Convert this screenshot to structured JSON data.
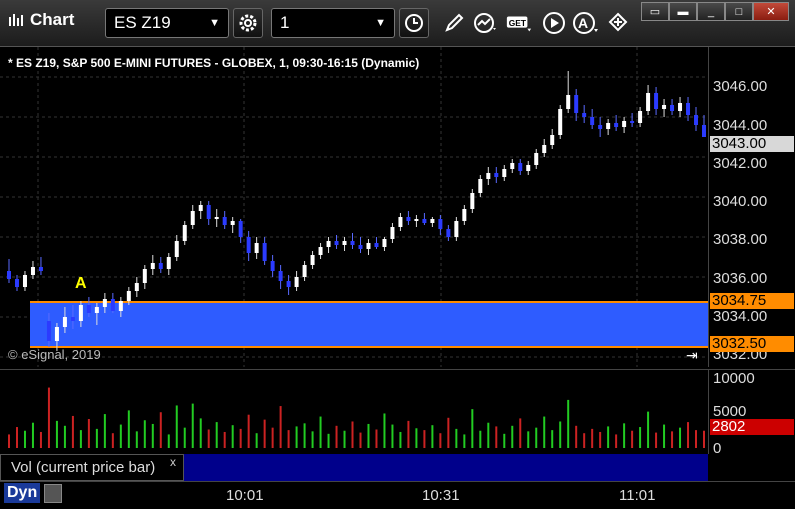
{
  "window": {
    "title": "Chart",
    "symbol": "ES Z19",
    "interval": "1",
    "buttons": [
      "clock-icon",
      "pencil-icon",
      "chart-line-icon",
      "get-icon",
      "play-icon",
      "a-circle-icon",
      "move-icon"
    ]
  },
  "chart": {
    "header": "* ES Z19, S&P 500 E-MINI FUTURES - GLOBEX, 1, 09:30-16:15 (Dynamic)",
    "copyright": "© eSignal, 2019",
    "marker": "A",
    "price_labels": [
      "3046.00",
      "3044.00",
      "3042.00",
      "3040.00",
      "3038.00",
      "3036.00",
      "3034.00",
      "3032.00"
    ],
    "current_price": "3043.00",
    "zone_high": "3034.75",
    "zone_low": "3032.50",
    "colors": {
      "up": "#ffffff",
      "down": "#2b3bff",
      "zone": "#2e5cff",
      "zone_line": "#ff8c00",
      "vol_up": "#22cc22",
      "vol_down": "#cc2222"
    }
  },
  "volume": {
    "study_label": "Vol (current price bar)",
    "close_label": "x",
    "axis_labels": [
      "10000",
      "5000",
      "0"
    ],
    "current": "2802"
  },
  "time_axis": {
    "labels": [
      "10:01",
      "10:31",
      "11:01"
    ],
    "mode": "Dyn"
  },
  "chart_data": {
    "type": "candlestick",
    "ylim": [
      3031.5,
      3047.5
    ],
    "zone": [
      3032.5,
      3034.75
    ],
    "bars": [
      [
        3036.3,
        3036.9,
        3035.7,
        3035.9
      ],
      [
        3035.9,
        3036.1,
        3035.3,
        3035.5
      ],
      [
        3035.5,
        3036.3,
        3035.3,
        3036.1
      ],
      [
        3036.1,
        3036.8,
        3035.9,
        3036.5
      ],
      [
        3036.5,
        3037.0,
        3036.1,
        3036.3
      ],
      [
        3033.8,
        3034.2,
        3032.5,
        3032.8
      ],
      [
        3032.8,
        3033.7,
        3032.3,
        3033.5
      ],
      [
        3033.5,
        3034.5,
        3033.2,
        3034.0
      ],
      [
        3034.0,
        3034.6,
        3033.4,
        3033.8
      ],
      [
        3033.8,
        3034.8,
        3033.5,
        3034.6
      ],
      [
        3034.6,
        3035.0,
        3034.0,
        3034.2
      ],
      [
        3034.2,
        3034.7,
        3033.6,
        3034.5
      ],
      [
        3034.5,
        3035.2,
        3034.2,
        3034.9
      ],
      [
        3034.9,
        3035.2,
        3034.2,
        3034.3
      ],
      [
        3034.3,
        3035.0,
        3034.0,
        3034.8
      ],
      [
        3034.8,
        3035.5,
        3034.6,
        3035.3
      ],
      [
        3035.3,
        3036.0,
        3035.0,
        3035.7
      ],
      [
        3035.7,
        3036.6,
        3035.4,
        3036.4
      ],
      [
        3036.4,
        3037.1,
        3036.1,
        3036.7
      ],
      [
        3036.7,
        3037.0,
        3036.2,
        3036.4
      ],
      [
        3036.4,
        3037.2,
        3036.1,
        3037.0
      ],
      [
        3037.0,
        3038.1,
        3036.8,
        3037.8
      ],
      [
        3037.8,
        3038.8,
        3037.6,
        3038.6
      ],
      [
        3038.6,
        3039.6,
        3038.4,
        3039.3
      ],
      [
        3039.3,
        3039.8,
        3038.9,
        3039.6
      ],
      [
        3039.6,
        3039.8,
        3038.6,
        3038.9
      ],
      [
        3038.9,
        3039.4,
        3038.5,
        3039.0
      ],
      [
        3039.0,
        3039.3,
        3038.4,
        3038.6
      ],
      [
        3038.6,
        3039.0,
        3038.2,
        3038.8
      ],
      [
        3038.8,
        3038.9,
        3037.7,
        3038.0
      ],
      [
        3038.0,
        3038.3,
        3036.8,
        3037.2
      ],
      [
        3037.2,
        3038.0,
        3036.9,
        3037.7
      ],
      [
        3037.7,
        3038.0,
        3036.6,
        3036.8
      ],
      [
        3036.8,
        3037.1,
        3036.0,
        3036.3
      ],
      [
        3036.3,
        3036.6,
        3035.4,
        3035.8
      ],
      [
        3035.8,
        3036.1,
        3035.1,
        3035.5
      ],
      [
        3035.5,
        3036.3,
        3035.3,
        3036.0
      ],
      [
        3036.0,
        3036.8,
        3035.8,
        3036.6
      ],
      [
        3036.6,
        3037.3,
        3036.4,
        3037.1
      ],
      [
        3037.1,
        3037.7,
        3036.9,
        3037.5
      ],
      [
        3037.5,
        3038.0,
        3037.2,
        3037.8
      ],
      [
        3037.8,
        3038.1,
        3037.4,
        3037.6
      ],
      [
        3037.6,
        3038.0,
        3037.3,
        3037.8
      ],
      [
        3037.8,
        3038.2,
        3037.4,
        3037.6
      ],
      [
        3037.6,
        3038.0,
        3037.2,
        3037.4
      ],
      [
        3037.4,
        3037.9,
        3037.1,
        3037.7
      ],
      [
        3037.7,
        3038.0,
        3037.4,
        3037.5
      ],
      [
        3037.5,
        3038.0,
        3037.3,
        3037.9
      ],
      [
        3037.9,
        3038.7,
        3037.7,
        3038.5
      ],
      [
        3038.5,
        3039.2,
        3038.3,
        3039.0
      ],
      [
        3039.0,
        3039.3,
        3038.6,
        3038.8
      ],
      [
        3038.8,
        3039.1,
        3038.5,
        3038.9
      ],
      [
        3038.9,
        3039.2,
        3038.6,
        3038.7
      ],
      [
        3038.7,
        3039.0,
        3038.5,
        3038.9
      ],
      [
        3038.9,
        3039.1,
        3038.1,
        3038.4
      ],
      [
        3038.4,
        3038.6,
        3037.8,
        3038.0
      ],
      [
        3038.0,
        3039.0,
        3037.8,
        3038.8
      ],
      [
        3038.8,
        3039.6,
        3038.6,
        3039.4
      ],
      [
        3039.4,
        3040.4,
        3039.2,
        3040.2
      ],
      [
        3040.2,
        3041.1,
        3040.0,
        3040.9
      ],
      [
        3040.9,
        3041.5,
        3040.6,
        3041.2
      ],
      [
        3041.2,
        3041.5,
        3040.7,
        3041.0
      ],
      [
        3041.0,
        3041.6,
        3040.8,
        3041.4
      ],
      [
        3041.4,
        3041.9,
        3041.2,
        3041.7
      ],
      [
        3041.7,
        3041.9,
        3041.1,
        3041.3
      ],
      [
        3041.3,
        3041.8,
        3041.1,
        3041.6
      ],
      [
        3041.6,
        3042.4,
        3041.4,
        3042.2
      ],
      [
        3042.2,
        3042.9,
        3042.0,
        3042.6
      ],
      [
        3042.6,
        3043.4,
        3042.4,
        3043.1
      ],
      [
        3043.1,
        3044.6,
        3042.9,
        3044.4
      ],
      [
        3044.4,
        3046.3,
        3044.2,
        3045.1
      ],
      [
        3045.1,
        3045.4,
        3043.8,
        3044.2
      ],
      [
        3044.2,
        3044.6,
        3043.7,
        3044.0
      ],
      [
        3044.0,
        3044.4,
        3043.4,
        3043.6
      ],
      [
        3043.6,
        3044.0,
        3043.0,
        3043.4
      ],
      [
        3043.4,
        3043.9,
        3043.1,
        3043.7
      ],
      [
        3043.7,
        3044.1,
        3043.3,
        3043.5
      ],
      [
        3043.5,
        3044.0,
        3043.2,
        3043.8
      ],
      [
        3043.8,
        3044.2,
        3043.5,
        3043.7
      ],
      [
        3043.7,
        3044.5,
        3043.5,
        3044.3
      ],
      [
        3044.3,
        3045.6,
        3044.1,
        3045.2
      ],
      [
        3045.2,
        3045.5,
        3044.1,
        3044.4
      ],
      [
        3044.4,
        3044.9,
        3044.0,
        3044.6
      ],
      [
        3044.6,
        3044.9,
        3044.1,
        3044.3
      ],
      [
        3044.3,
        3045.0,
        3044.0,
        3044.7
      ],
      [
        3044.7,
        3045.0,
        3043.8,
        3044.1
      ],
      [
        3044.1,
        3044.5,
        3043.3,
        3043.6
      ],
      [
        3043.6,
        3044.1,
        3043.2,
        3043.0
      ]
    ],
    "volume": [
      2200,
      3400,
      2800,
      4100,
      2600,
      9800,
      4400,
      3600,
      5200,
      2900,
      4700,
      3100,
      5500,
      2400,
      3800,
      6100,
      2700,
      4500,
      3900,
      5800,
      2200,
      6900,
      3300,
      7200,
      4800,
      3000,
      4200,
      2600,
      3700,
      3100,
      5400,
      2400,
      4600,
      3300,
      6800,
      2900,
      3500,
      4000,
      2700,
      5100,
      2300,
      3600,
      2800,
      4300,
      2500,
      3900,
      3000,
      5600,
      3800,
      2600,
      4400,
      3200,
      2900,
      3700,
      2400,
      4900,
      3100,
      2200,
      6300,
      2800,
      4100,
      3500,
      2300,
      3600,
      4800,
      2700,
      3300,
      5100,
      2900,
      4300,
      7800,
      3600,
      2400,
      3100,
      2600,
      3500,
      2200,
      4000,
      2800,
      3400,
      5900,
      2500,
      3800,
      2700,
      3300,
      4200,
      2900,
      2802
    ]
  }
}
